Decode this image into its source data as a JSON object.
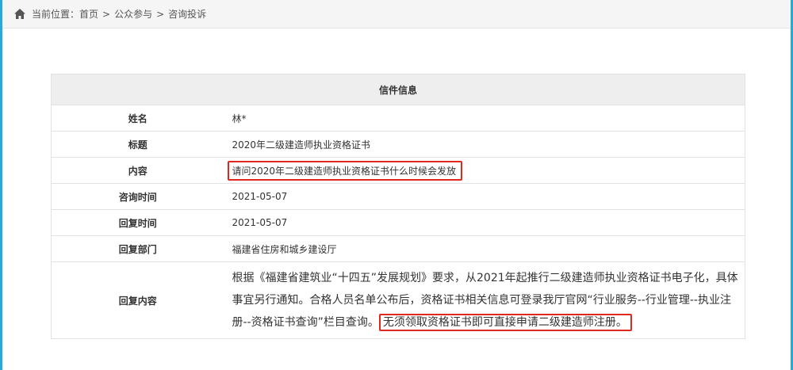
{
  "breadcrumb": {
    "prefix": "当前位置：",
    "items": [
      "首页",
      "公众参与",
      "咨询投诉"
    ],
    "separator": ">"
  },
  "letter": {
    "title": "信件信息",
    "rows": [
      {
        "label": "姓名",
        "value": "林*"
      },
      {
        "label": "标题",
        "value": "2020年二级建造师执业资格证书"
      },
      {
        "label": "内容",
        "value": "请问2020年二级建造师执业资格证书什么时候会发放"
      },
      {
        "label": "咨询时间",
        "value": "2021-05-07"
      },
      {
        "label": "回复时间",
        "value": "2021-05-07"
      },
      {
        "label": "回复部门",
        "value": "福建省住房和城乡建设厅"
      },
      {
        "label": "回复内容"
      }
    ],
    "reply": {
      "text": "根据《福建省建筑业“十四五”发展规划》要求，从2021年起推行二级建造师执业资格证书电子化，具体事宜另行通知。合格人员名单公布后，资格证书相关信息可登录我厅官网“行业服务--行业管理--执业注册--资格证书查询”栏目查询。",
      "highlight": "无须领取资格证书即可直接申请二级建造师注册。"
    }
  },
  "colors": {
    "highlight_border": "#e0281f",
    "frame": "#29a8e0"
  }
}
